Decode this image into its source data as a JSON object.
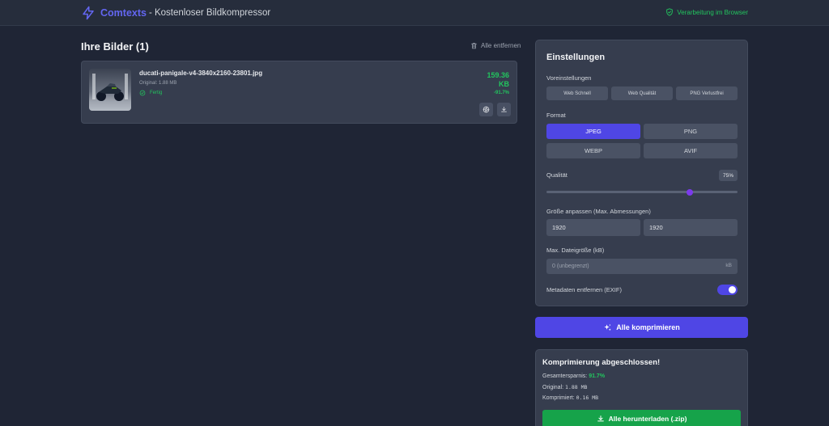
{
  "header": {
    "brand_name": "Comtexts",
    "subtitle": "- Kostenloser Bildkompressor",
    "privacy_note": "Verarbeitung im Browser"
  },
  "images": {
    "title": "Ihre Bilder (1)",
    "remove_all": "Alle entfernen",
    "items": [
      {
        "filename": "ducati-panigale-v4-3840x2160-23801.jpg",
        "original": "Original: 1.88 MB",
        "status": "Fertig",
        "size_value": "159.36",
        "size_unit": "KB",
        "reduction": "-91.7%"
      }
    ]
  },
  "settings": {
    "title": "Einstellungen",
    "presets_label": "Voreinstellungen",
    "presets": [
      "Web Schnell",
      "Web Qualität",
      "PNG Verlustfrei"
    ],
    "format_label": "Format",
    "formats": [
      "JPEG",
      "PNG",
      "WEBP",
      "AVIF"
    ],
    "selected_format": "JPEG",
    "quality_label": "Qualität",
    "quality_value": "75%",
    "quality_level": 0.75,
    "resize_label": "Größe anpassen (Max. Abmessungen)",
    "width_value": "1920",
    "height_value": "1920",
    "maxsize_label": "Max. Dateigröße (kB)",
    "maxsize_placeholder": "0 (unbegrenzt)",
    "maxsize_unit": "kB",
    "metadata_label": "Metadaten entfernen (EXIF)",
    "metadata_enabled": true
  },
  "actions": {
    "compress_all": "Alle komprimieren"
  },
  "summary": {
    "title": "Komprimierung abgeschlossen!",
    "savings_label": "Gesamtersparnis:",
    "savings_value": "91.7%",
    "original_label": "Original:",
    "original_value": "1.88 MB",
    "compressed_label": "Komprimiert:",
    "compressed_value": "0.16 MB",
    "download_all": "Alle herunterladen (.zip)"
  },
  "colors": {
    "accent": "#4f46e5",
    "success": "#22c55e",
    "background": "#1f2535",
    "card": "#363d4e"
  }
}
